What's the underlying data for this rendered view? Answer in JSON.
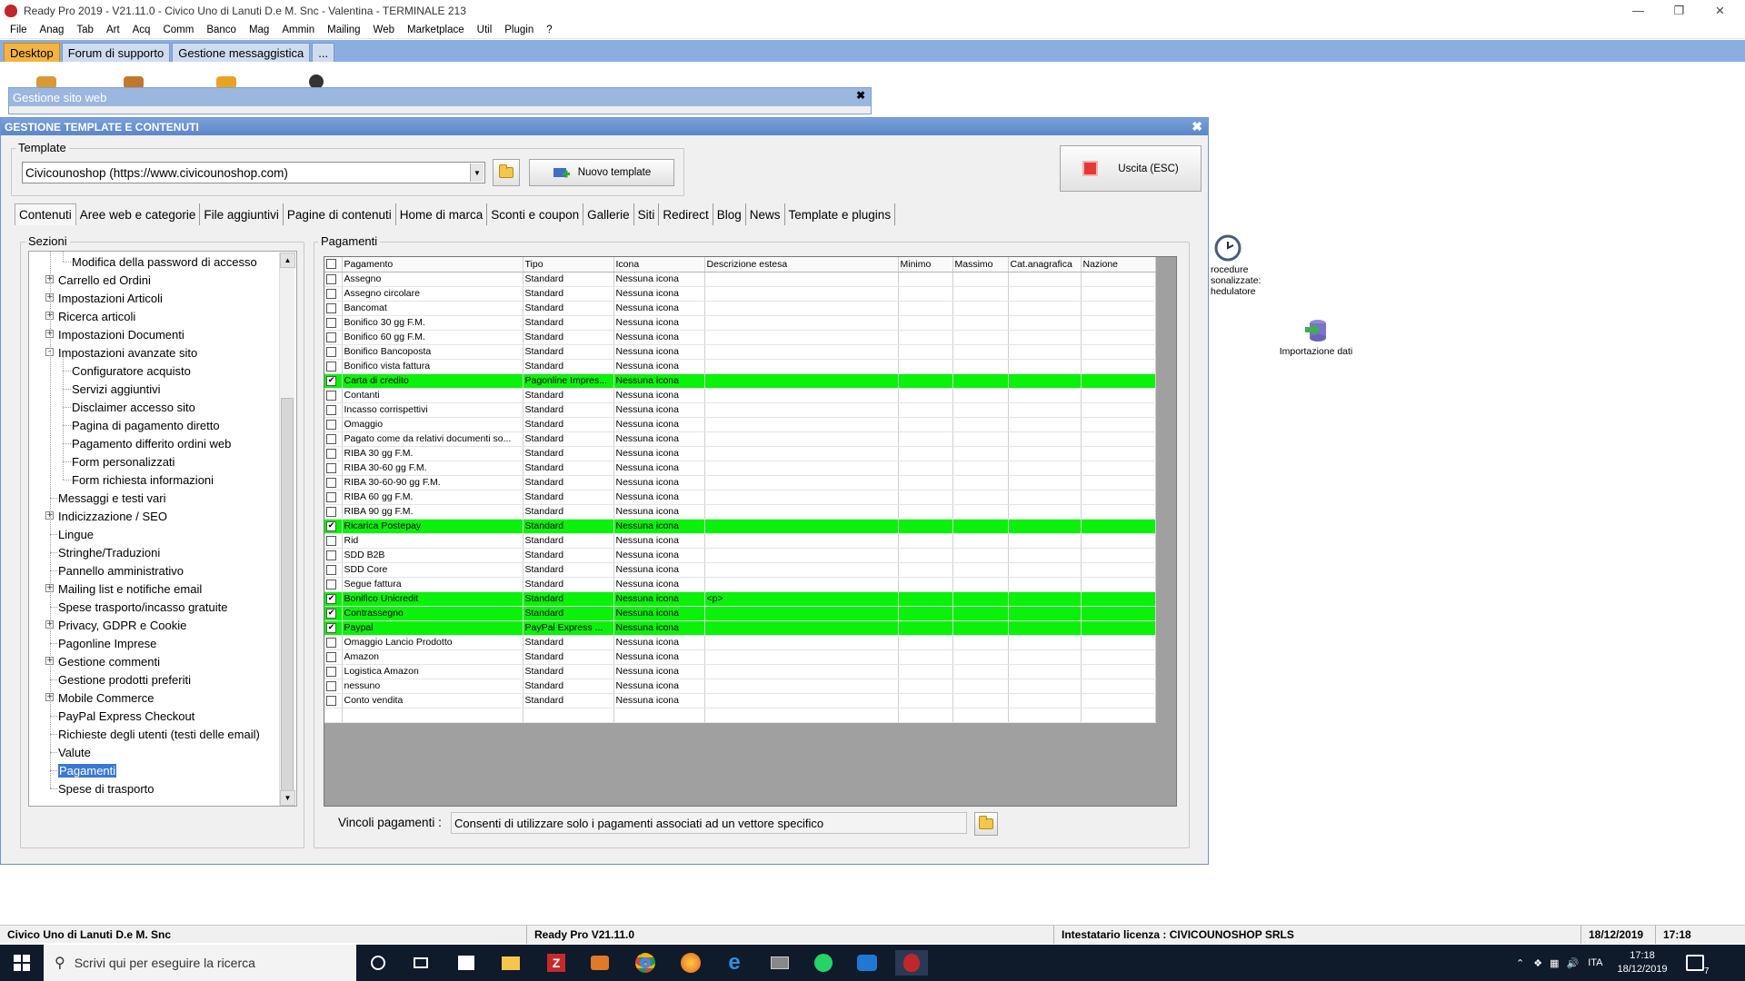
{
  "window": {
    "title": "Ready Pro 2019 - V21.11.0 - Civico Uno di Lanuti D.e M. Snc - Valentina - TERMINALE 213",
    "controls": [
      "minimize-icon",
      "restore-icon",
      "close-icon"
    ]
  },
  "menu": [
    "File",
    "Anag",
    "Tab",
    "Art",
    "Acq",
    "Comm",
    "Banco",
    "Mag",
    "Ammin",
    "Mailing",
    "Web",
    "Marketplace",
    "Util",
    "Plugin",
    "?"
  ],
  "quick_tabs": [
    "Desktop",
    "Forum di supporto",
    "Gestione messaggistica",
    "..."
  ],
  "background_window": {
    "title": "Gestione sito web"
  },
  "desktop_icons": [
    {
      "label_lines": [
        "rocedure",
        "sonalizzate:",
        "hedulatore"
      ],
      "icon": "clock-icon"
    },
    {
      "label": "Importazione dati",
      "icon": "database-import-icon"
    }
  ],
  "dialog": {
    "title": "GESTIONE TEMPLATE E CONTENUTI",
    "template_group": "Template",
    "template_value": "Civicounoshop (https://www.civicounoshop.com)",
    "new_template_label": "Nuovo template",
    "exit_label": "Uscita (ESC)",
    "tabs": [
      "Contenuti",
      "Aree web e categorie",
      "File aggiuntivi",
      "Pagine di contenuti",
      "Home di marca",
      "Sconti e coupon",
      "Gallerie",
      "Siti",
      "Redirect",
      "Blog",
      "News",
      "Template e plugins"
    ],
    "sections_title": "Sezioni",
    "sections": [
      {
        "label": "Modifica della password di accesso",
        "level": 2,
        "exp": ""
      },
      {
        "label": "Carrello ed Ordini",
        "level": 1,
        "exp": "+"
      },
      {
        "label": "Impostazioni Articoli",
        "level": 1,
        "exp": "+"
      },
      {
        "label": "Ricerca articoli",
        "level": 1,
        "exp": "+"
      },
      {
        "label": "Impostazioni Documenti",
        "level": 1,
        "exp": "+"
      },
      {
        "label": "Impostazioni avanzate sito",
        "level": 1,
        "exp": "-"
      },
      {
        "label": "Configuratore acquisto",
        "level": 2,
        "exp": ""
      },
      {
        "label": "Servizi aggiuntivi",
        "level": 2,
        "exp": ""
      },
      {
        "label": "Disclaimer accesso sito",
        "level": 2,
        "exp": ""
      },
      {
        "label": "Pagina di pagamento diretto",
        "level": 2,
        "exp": ""
      },
      {
        "label": "Pagamento differito ordini web",
        "level": 2,
        "exp": ""
      },
      {
        "label": "Form personalizzati",
        "level": 2,
        "exp": ""
      },
      {
        "label": "Form richiesta informazioni",
        "level": 2,
        "exp": ""
      },
      {
        "label": "Messaggi e testi vari",
        "level": 1,
        "exp": ""
      },
      {
        "label": "Indicizzazione / SEO",
        "level": 1,
        "exp": "+"
      },
      {
        "label": "Lingue",
        "level": 1,
        "exp": ""
      },
      {
        "label": "Stringhe/Traduzioni",
        "level": 1,
        "exp": ""
      },
      {
        "label": "Pannello amministrativo",
        "level": 1,
        "exp": ""
      },
      {
        "label": "Mailing list e notifiche email",
        "level": 1,
        "exp": "+"
      },
      {
        "label": "Spese trasporto/incasso gratuite",
        "level": 1,
        "exp": ""
      },
      {
        "label": "Privacy, GDPR e Cookie",
        "level": 1,
        "exp": "+"
      },
      {
        "label": "Pagonline Imprese",
        "level": 1,
        "exp": ""
      },
      {
        "label": "Gestione commenti",
        "level": 1,
        "exp": "+"
      },
      {
        "label": "Gestione prodotti preferiti",
        "level": 1,
        "exp": ""
      },
      {
        "label": "Mobile Commerce",
        "level": 1,
        "exp": "+"
      },
      {
        "label": "PayPal Express Checkout",
        "level": 1,
        "exp": ""
      },
      {
        "label": "Richieste degli utenti (testi delle email)",
        "level": 1,
        "exp": ""
      },
      {
        "label": "Valute",
        "level": 1,
        "exp": ""
      },
      {
        "label": "Pagamenti",
        "level": 1,
        "exp": "",
        "selected": true
      },
      {
        "label": "Spese di trasporto",
        "level": 1,
        "exp": ""
      }
    ],
    "payments_title": "Pagamenti",
    "columns": [
      "Pagamento",
      "Tipo",
      "Icona",
      "Descrizione estesa",
      "Minimo",
      "Massimo",
      "Cat.anagrafica",
      "Nazione"
    ],
    "rows": [
      {
        "name": "Assegno",
        "tipo": "Standard",
        "icona": "Nessuna icona",
        "desc": "",
        "checked": false
      },
      {
        "name": "Assegno circolare",
        "tipo": "Standard",
        "icona": "Nessuna icona",
        "desc": "",
        "checked": false
      },
      {
        "name": "Bancomat",
        "tipo": "Standard",
        "icona": "Nessuna icona",
        "desc": "",
        "checked": false
      },
      {
        "name": "Bonifico 30 gg F.M.",
        "tipo": "Standard",
        "icona": "Nessuna icona",
        "desc": "",
        "checked": false
      },
      {
        "name": "Bonifico 60 gg F.M.",
        "tipo": "Standard",
        "icona": "Nessuna icona",
        "desc": "",
        "checked": false
      },
      {
        "name": "Bonifico Bancoposta",
        "tipo": "Standard",
        "icona": "Nessuna icona",
        "desc": "",
        "checked": false
      },
      {
        "name": "Bonifico vista fattura",
        "tipo": "Standard",
        "icona": "Nessuna icona",
        "desc": "",
        "checked": false
      },
      {
        "name": "Carta di credito",
        "tipo": "Pagonline Impres...",
        "icona": "Nessuna icona",
        "desc": "",
        "checked": true
      },
      {
        "name": "Contanti",
        "tipo": "Standard",
        "icona": "Nessuna icona",
        "desc": "",
        "checked": false
      },
      {
        "name": "Incasso corrispettivi",
        "tipo": "Standard",
        "icona": "Nessuna icona",
        "desc": "",
        "checked": false
      },
      {
        "name": "Omaggio",
        "tipo": "Standard",
        "icona": "Nessuna icona",
        "desc": "",
        "checked": false
      },
      {
        "name": "Pagato come da relativi documenti so...",
        "tipo": "Standard",
        "icona": "Nessuna icona",
        "desc": "",
        "checked": false
      },
      {
        "name": "RIBA 30 gg F.M.",
        "tipo": "Standard",
        "icona": "Nessuna icona",
        "desc": "",
        "checked": false
      },
      {
        "name": "RIBA 30-60 gg F.M.",
        "tipo": "Standard",
        "icona": "Nessuna icona",
        "desc": "",
        "checked": false
      },
      {
        "name": "RIBA 30-60-90 gg F.M.",
        "tipo": "Standard",
        "icona": "Nessuna icona",
        "desc": "",
        "checked": false
      },
      {
        "name": "RIBA 60 gg F.M.",
        "tipo": "Standard",
        "icona": "Nessuna icona",
        "desc": "",
        "checked": false
      },
      {
        "name": "RIBA 90 gg F.M.",
        "tipo": "Standard",
        "icona": "Nessuna icona",
        "desc": "",
        "checked": false
      },
      {
        "name": "Ricarica Postepay",
        "tipo": "Standard",
        "icona": "Nessuna icona",
        "desc": "",
        "checked": true
      },
      {
        "name": "Rid",
        "tipo": "Standard",
        "icona": "Nessuna icona",
        "desc": "",
        "checked": false
      },
      {
        "name": "SDD B2B",
        "tipo": "Standard",
        "icona": "Nessuna icona",
        "desc": "",
        "checked": false
      },
      {
        "name": "SDD Core",
        "tipo": "Standard",
        "icona": "Nessuna icona",
        "desc": "",
        "checked": false
      },
      {
        "name": "Segue fattura",
        "tipo": "Standard",
        "icona": "Nessuna icona",
        "desc": "",
        "checked": false
      },
      {
        "name": "Bonifico Unicredit",
        "tipo": "Standard",
        "icona": "Nessuna icona",
        "desc": "<p>",
        "checked": true
      },
      {
        "name": "Contrassegno",
        "tipo": "Standard",
        "icona": "Nessuna icona",
        "desc": "",
        "checked": true
      },
      {
        "name": "Paypal",
        "tipo": "PayPal Express ...",
        "icona": "Nessuna icona",
        "desc": "",
        "checked": true
      },
      {
        "name": "Omaggio Lancio Prodotto",
        "tipo": "Standard",
        "icona": "Nessuna icona",
        "desc": "",
        "checked": false
      },
      {
        "name": "Amazon",
        "tipo": "Standard",
        "icona": "Nessuna icona",
        "desc": "",
        "checked": false
      },
      {
        "name": "Logistica Amazon",
        "tipo": "Standard",
        "icona": "Nessuna icona",
        "desc": "",
        "checked": false
      },
      {
        "name": "nessuno",
        "tipo": "Standard",
        "icona": "Nessuna icona",
        "desc": "",
        "checked": false
      },
      {
        "name": "Conto vendita",
        "tipo": "Standard",
        "icona": "Nessuna icona",
        "desc": "",
        "checked": false
      }
    ],
    "vincoli_label": "Vincoli pagamenti :",
    "vincoli_value": "Consenti di utilizzare solo i pagamenti associati ad un vettore specifico"
  },
  "status": {
    "company": "Civico Uno di Lanuti D.e M. Snc",
    "version": "Ready Pro V21.11.0",
    "license": "Intestatario licenza : CIVICOUNOSHOP SRLS",
    "date": "18/12/2019",
    "time": "17:18"
  },
  "taskbar": {
    "search_placeholder": "Scrivi qui per eseguire la ricerca",
    "language": "ITA",
    "clock_time": "17:18",
    "clock_date": "18/12/2019",
    "notifications": "7"
  },
  "colors": {
    "highlight": "#0af20a",
    "accent_tab": "#f5b342",
    "header_blue": "#5b86c8"
  }
}
